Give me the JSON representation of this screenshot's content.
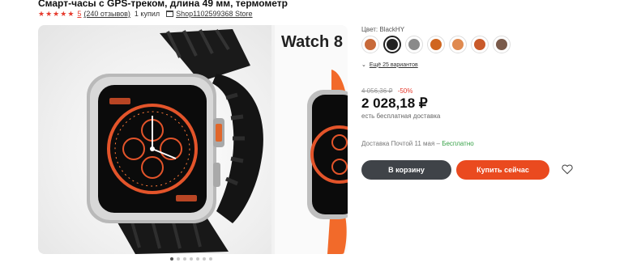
{
  "product": {
    "title": "Смарт-часы с GPS-треком, длина 49 мм, термометр",
    "rating": "5",
    "reviews": "(240 отзывов)",
    "bought": "1 купил",
    "store": "Shop1102599368 Store"
  },
  "gallery": {
    "second_slide_title": "Watch 8",
    "dots_count": 7,
    "active_dot": 0
  },
  "options": {
    "color_label": "Цвет: BlackHY",
    "swatch_colors": [
      "#c86a3a",
      "#222222",
      "#8a8a8a",
      "#d0661f",
      "#e08a50",
      "#c95a2a",
      "#7a5a4a"
    ],
    "selected_index": 1,
    "more_variants": "Ещё 25 вариантов"
  },
  "pricing": {
    "old_price": "4 056,36 ₽",
    "discount": "-50%",
    "price": "2 028,18 ₽",
    "free_shipping": "есть бесплатная доставка"
  },
  "delivery": {
    "text": "Доставка Почтой 11 мая – ",
    "free": "Бесплатно"
  },
  "actions": {
    "cart": "В корзину",
    "buy": "Купить сейчас"
  },
  "colors": {
    "accent": "#ea4a1f",
    "dark_button": "#3f4348",
    "star": "#e63b2e",
    "green": "#3aa34a"
  }
}
